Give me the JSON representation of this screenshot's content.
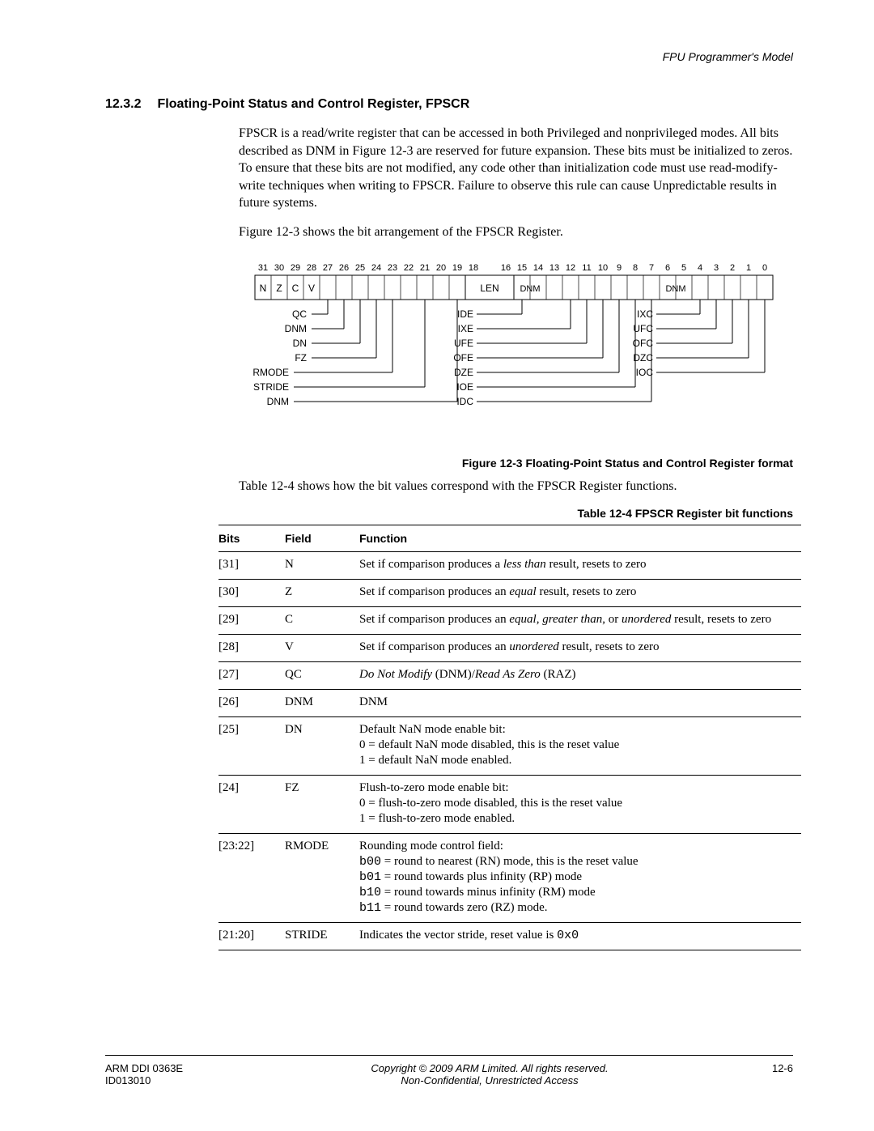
{
  "running_head": "FPU Programmer's Model",
  "section": {
    "num": "12.3.2",
    "title": "Floating-Point Status and Control Register, FPSCR"
  },
  "paras": {
    "p1": "FPSCR is a read/write register that can be accessed in both Privileged and nonprivileged modes. All bits described as DNM in Figure 12-3 are reserved for future expansion. These bits must be initialized to zeros. To ensure that these bits are not modified, any code other than initialization code must use read-modify-write techniques when writing to FPSCR. Failure to observe this rule can cause Unpredictable results in future systems.",
    "p2": "Figure 12-3 shows the bit arrangement of the FPSCR Register.",
    "p3": "Table 12-4 shows how the bit values correspond with the FPSCR Register functions."
  },
  "figure": {
    "caption": "Figure 12-3 Floating-Point Status and Control Register format",
    "bit_numbers": [
      "31",
      "30",
      "29",
      "28",
      "27",
      "26",
      "25",
      "24",
      "23",
      "22",
      "21",
      "20",
      "19",
      "18",
      "",
      "16",
      "15",
      "14",
      "13",
      "12",
      "11",
      "10",
      "9",
      "8",
      "7",
      "6",
      "5",
      "4",
      "3",
      "2",
      "1",
      "0"
    ],
    "top_cells": {
      "N": "N",
      "Z": "Z",
      "C": "C",
      "V": "V",
      "LEN": "LEN",
      "DNM1": "DNM",
      "DNM2": "DNM"
    },
    "left_labels": [
      "QC",
      "DNM",
      "DN",
      "FZ",
      "RMODE",
      "STRIDE",
      "DNM"
    ],
    "mid_labels": [
      "IDE",
      "IXE",
      "UFE",
      "OFE",
      "DZE",
      "IOE",
      "IDC"
    ],
    "right_labels": [
      "IXC",
      "UFC",
      "OFC",
      "DZC",
      "IOC"
    ]
  },
  "table": {
    "caption": "Table 12-4 FPSCR Register bit functions",
    "headers": {
      "bits": "Bits",
      "field": "Field",
      "func": "Function"
    },
    "rows": [
      {
        "bits": "[31]",
        "field": "N",
        "func": [
          {
            "pre": "Set if comparison produces a ",
            "em": "less than",
            "post": " result, resets to zero"
          }
        ]
      },
      {
        "bits": "[30]",
        "field": "Z",
        "func": [
          {
            "pre": "Set if comparison produces an ",
            "em": "equal",
            "post": " result, resets to zero"
          }
        ]
      },
      {
        "bits": "[29]",
        "field": "C",
        "func": [
          {
            "pre": "Set if comparison produces an ",
            "em": "equal",
            "mid": ", ",
            "em2": "greater than",
            "mid2": ", or ",
            "em3": "unordered",
            "post": " result, resets to zero"
          }
        ]
      },
      {
        "bits": "[28]",
        "field": "V",
        "func": [
          {
            "pre": "Set if comparison produces an ",
            "em": "unordered",
            "post": " result, resets to zero"
          }
        ]
      },
      {
        "bits": "[27]",
        "field": "QC",
        "func": [
          {
            "em": "Do Not Modify",
            "mid": " (DNM)/",
            "em2": "Read As Zero",
            "post": " (RAZ)"
          }
        ]
      },
      {
        "bits": "[26]",
        "field": "DNM",
        "func": [
          {
            "text": "DNM"
          }
        ]
      },
      {
        "bits": "[25]",
        "field": "DN",
        "func": [
          {
            "text": "Default NaN mode enable bit:"
          },
          {
            "text": "0 = default NaN mode disabled, this is the reset value"
          },
          {
            "text": "1 = default NaN mode enabled."
          }
        ]
      },
      {
        "bits": "[24]",
        "field": "FZ",
        "func": [
          {
            "text": "Flush-to-zero mode enable bit:"
          },
          {
            "text": "0 = flush-to-zero mode disabled, this is the reset value"
          },
          {
            "text": "1 = flush-to-zero mode enabled."
          }
        ]
      },
      {
        "bits": "[23:22]",
        "field": "RMODE",
        "func": [
          {
            "text": "Rounding mode control field:"
          },
          {
            "mono": "b00",
            "post": " = round to nearest (RN) mode, this is the reset value"
          },
          {
            "mono": "b01",
            "post": " = round towards plus infinity (RP) mode"
          },
          {
            "mono": "b10",
            "post": " = round towards minus infinity (RM) mode"
          },
          {
            "mono": "b11",
            "post": " = round towards zero (RZ) mode."
          }
        ]
      },
      {
        "bits": "[21:20]",
        "field": "STRIDE",
        "func": [
          {
            "pre": "Indicates the vector stride, reset value is ",
            "mono": "0x0"
          }
        ]
      }
    ]
  },
  "footer": {
    "left1": "ARM DDI 0363E",
    "left2": "ID013010",
    "center1": "Copyright © 2009 ARM Limited. All rights reserved.",
    "center2": "Non-Confidential, Unrestricted Access",
    "right": "12-6"
  }
}
